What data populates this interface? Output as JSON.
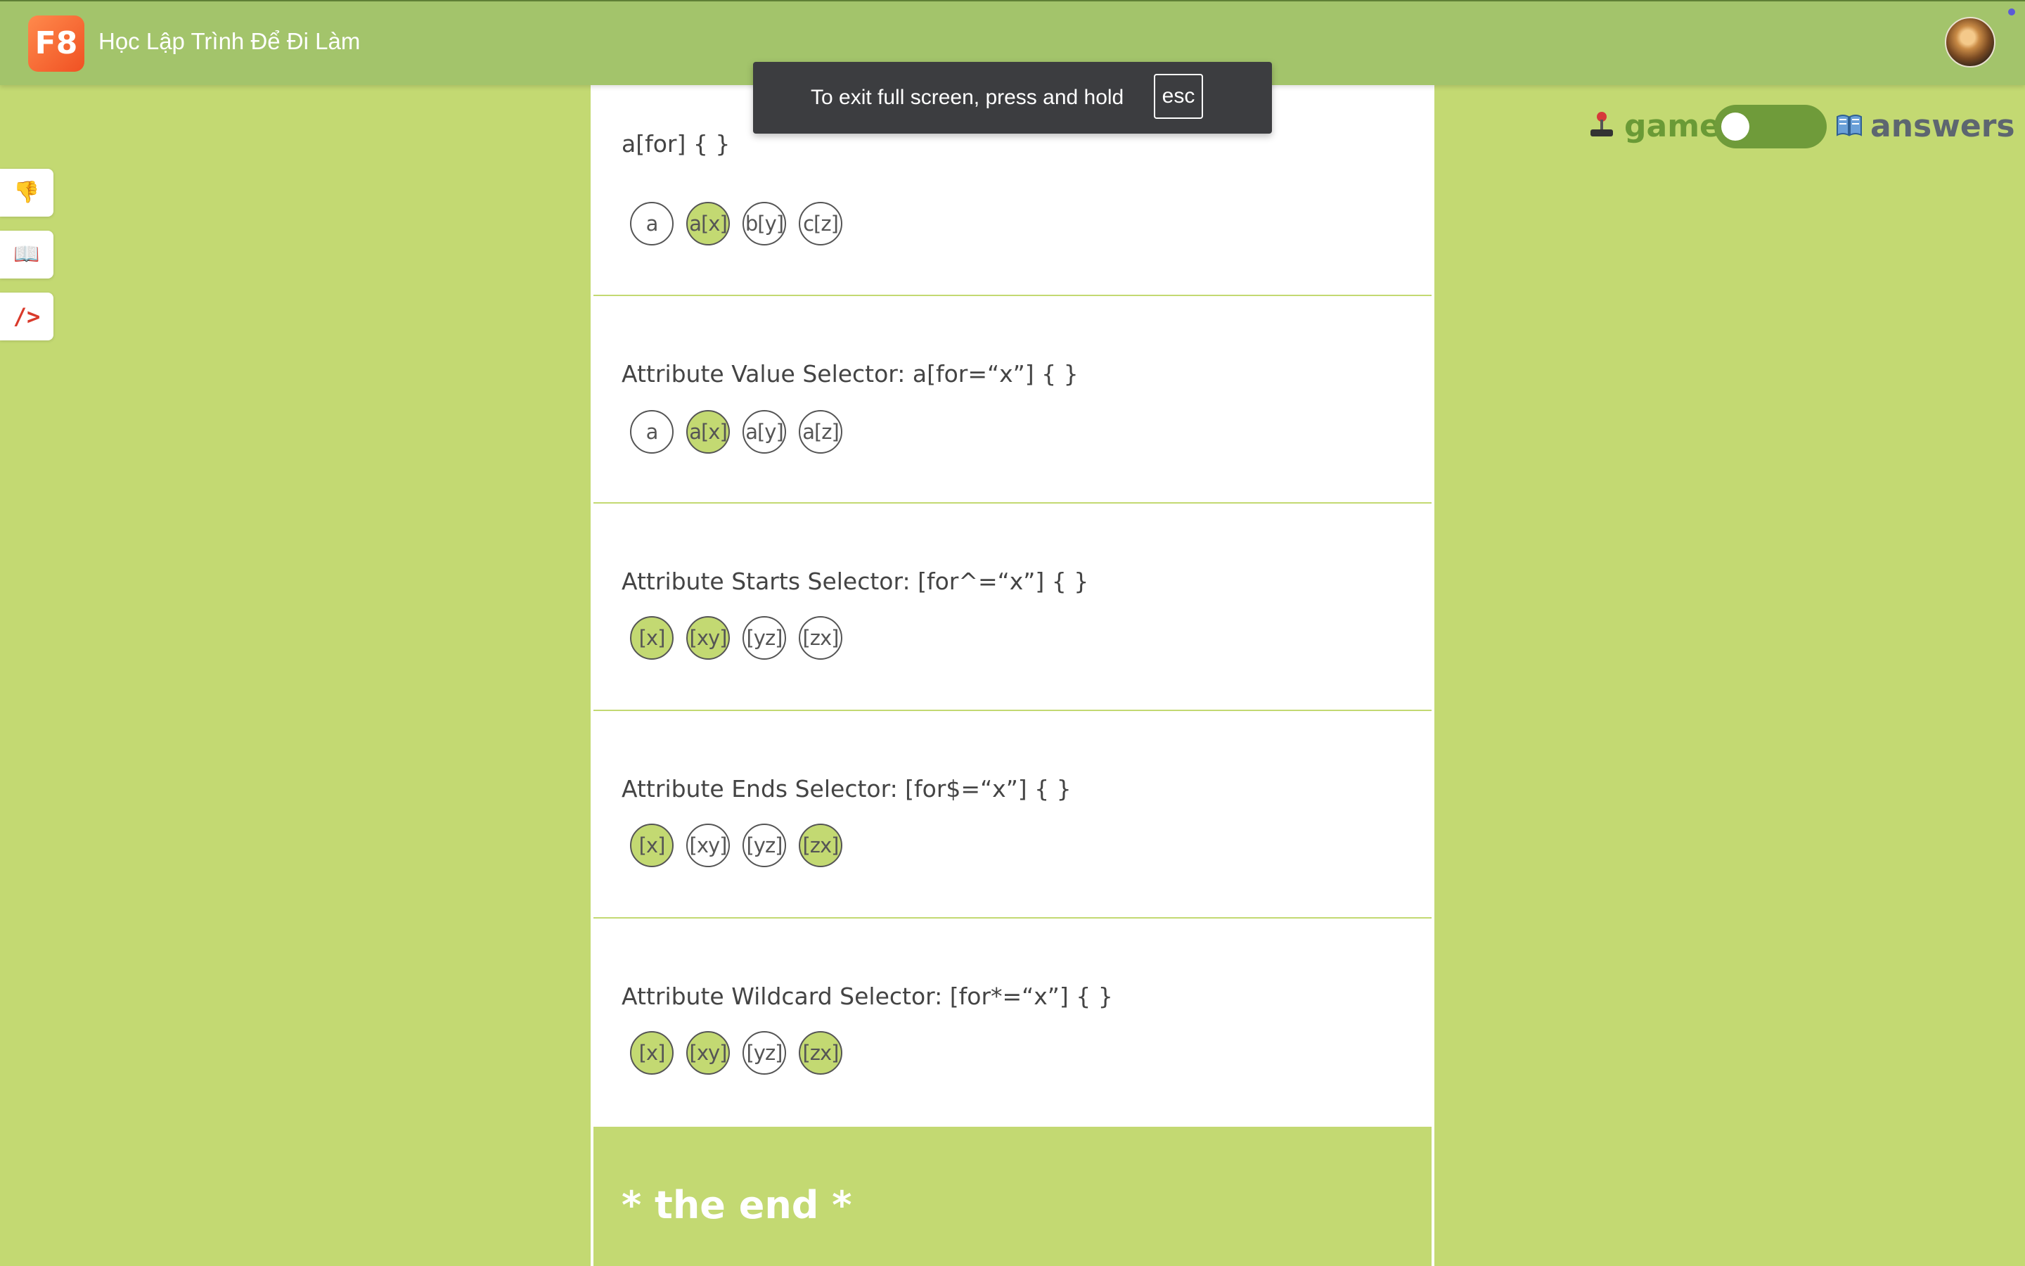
{
  "app": {
    "logo_text": "F8",
    "brand": "Học Lập Trình Để Đi Làm"
  },
  "toast": {
    "text": "To exit full screen, press and hold",
    "key": "esc"
  },
  "sidebar": {
    "buttons": [
      {
        "name": "thumbs-down-icon",
        "glyph": "👎"
      },
      {
        "name": "book-icon",
        "glyph": "📖"
      },
      {
        "name": "code-icon",
        "glyph": "/>"
      }
    ]
  },
  "mode_toggle": {
    "game_label": "game",
    "answers_label": "answers",
    "state": "game"
  },
  "sections": [
    {
      "title": "a[for] { }",
      "chips": [
        {
          "label": "a",
          "selected": false
        },
        {
          "label": "a[x]",
          "selected": true
        },
        {
          "label": "b[y]",
          "selected": false
        },
        {
          "label": "c[z]",
          "selected": false
        }
      ]
    },
    {
      "title": "Attribute Value Selector: a[for=“x”] { }",
      "chips": [
        {
          "label": "a",
          "selected": false
        },
        {
          "label": "a[x]",
          "selected": true
        },
        {
          "label": "a[y]",
          "selected": false
        },
        {
          "label": "a[z]",
          "selected": false
        }
      ]
    },
    {
      "title": "Attribute Starts Selector: [for^=“x”] { }",
      "chips": [
        {
          "label": "[x]",
          "selected": true
        },
        {
          "label": "[xy]",
          "selected": true
        },
        {
          "label": "[yz]",
          "selected": false
        },
        {
          "label": "[zx]",
          "selected": false
        }
      ]
    },
    {
      "title": "Attribute Ends Selector: [for$=“x”] { }",
      "chips": [
        {
          "label": "[x]",
          "selected": true
        },
        {
          "label": "[xy]",
          "selected": false
        },
        {
          "label": "[yz]",
          "selected": false
        },
        {
          "label": "[zx]",
          "selected": true
        }
      ]
    },
    {
      "title": "Attribute Wildcard Selector: [for*=“x”] { }",
      "chips": [
        {
          "label": "[x]",
          "selected": true
        },
        {
          "label": "[xy]",
          "selected": true
        },
        {
          "label": "[yz]",
          "selected": false
        },
        {
          "label": "[zx]",
          "selected": true
        }
      ]
    }
  ],
  "end_text": "* the end *"
}
